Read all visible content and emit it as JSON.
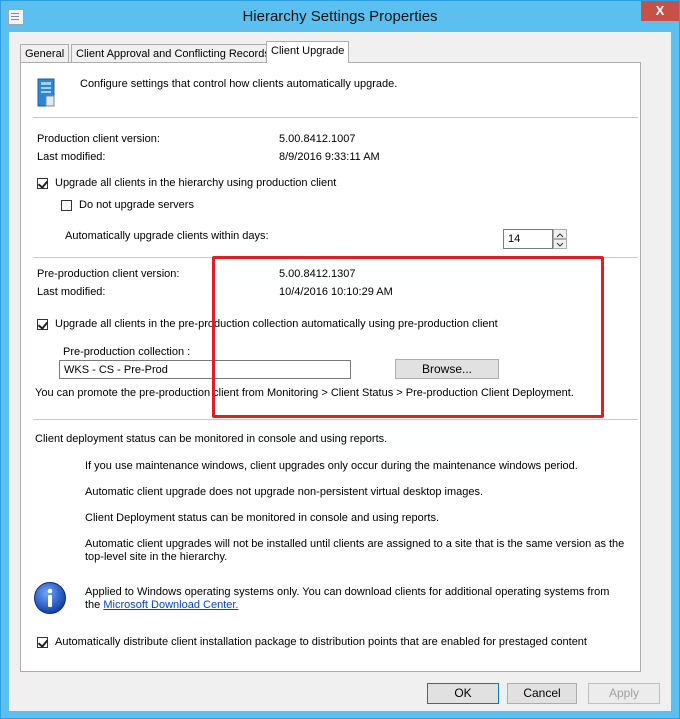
{
  "window": {
    "title": "Hierarchy Settings Properties",
    "close_glyph": "X"
  },
  "tabs": [
    "General",
    "Client Approval and Conflicting Records",
    "Client Upgrade"
  ],
  "header": {
    "description": "Configure settings that control how clients automatically upgrade."
  },
  "production": {
    "version_label": "Production client version:",
    "version_value": "5.00.8412.1007",
    "modified_label": "Last modified:",
    "modified_value": "8/9/2016 9:33:11 AM",
    "upgrade_label": "Upgrade all clients in the hierarchy using production client",
    "upgrade_checked": true,
    "no_servers_label": "Do not upgrade servers",
    "no_servers_checked": false,
    "days_label": "Automatically upgrade clients within days:",
    "days_value": "14"
  },
  "preproduction": {
    "version_label": "Pre-production client version:",
    "version_value": "5.00.8412.1307",
    "modified_label": "Last modified:",
    "modified_value": "10/4/2016 10:10:29 AM",
    "upgrade_label": "Upgrade all clients in the pre-production collection automatically using pre-production client",
    "upgrade_checked": true,
    "collection_label": "Pre-production collection :",
    "collection_value": "WKS - CS - Pre-Prod",
    "browse_label": "Browse...",
    "promote_text": "You can promote the pre-production client from Monitoring > Client Status > Pre-production Client Deployment."
  },
  "notes": {
    "status_text": "Client deployment status can be monitored in console and using reports.",
    "items": [
      "If you use maintenance windows, client upgrades only occur during the maintenance windows period.",
      "Automatic client upgrade does not upgrade non-persistent virtual desktop images.",
      "Client Deployment status can be monitored in console and using reports.",
      "Automatic client upgrades will not be installed until clients are assigned to a site that is the same version as the",
      "top-level site in the hierarchy."
    ]
  },
  "info": {
    "line1": "Applied to Windows operating systems only. You can download clients for additional operating systems from",
    "line2_prefix": "the",
    "link_text": "Microsoft Download Center."
  },
  "distribute": {
    "label": "Automatically distribute client installation package to distribution points that are enabled for prestaged content",
    "checked": true
  },
  "buttons": {
    "ok": "OK",
    "cancel": "Cancel",
    "apply": "Apply"
  }
}
